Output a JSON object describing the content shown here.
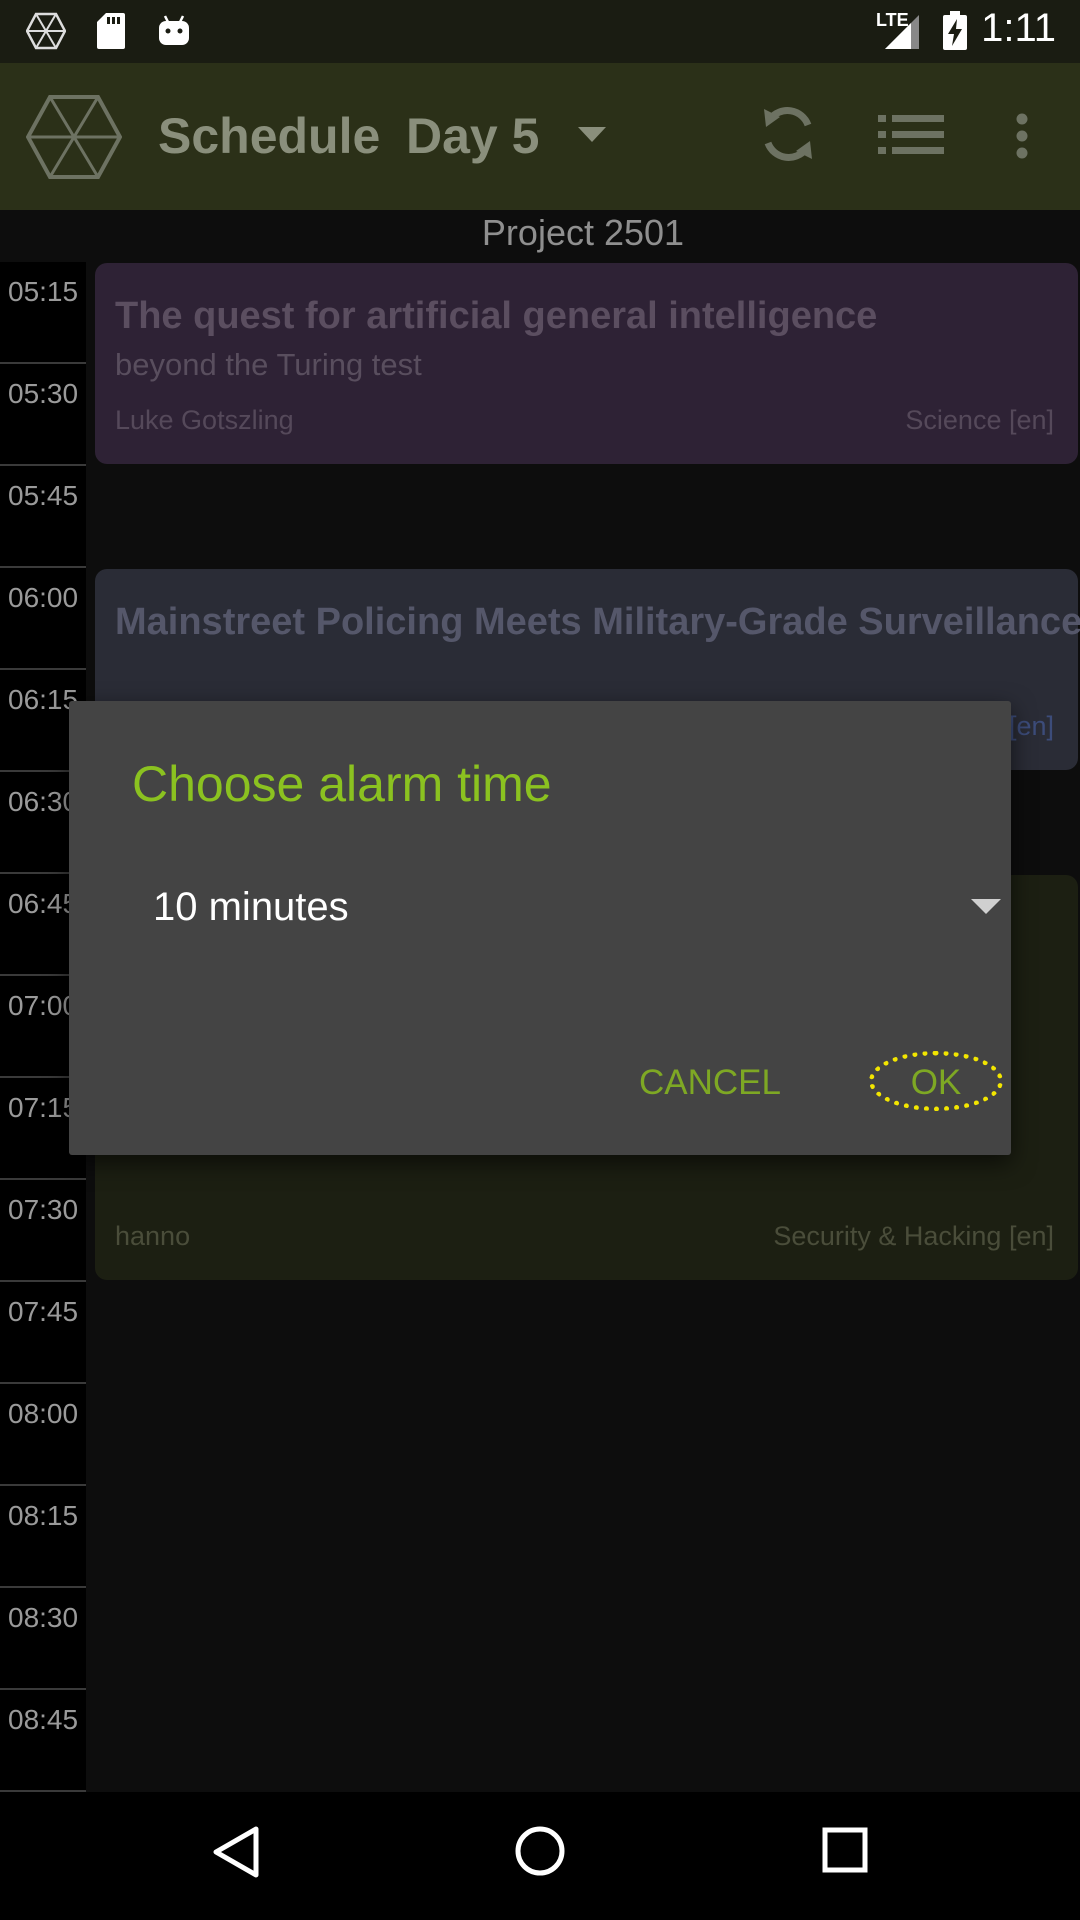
{
  "status_bar": {
    "time": "1:11",
    "network_label": "LTE",
    "icons": [
      "app-logo-icon",
      "sd-card-icon",
      "android-icon",
      "signal-icon",
      "battery-charging-icon"
    ]
  },
  "app_bar": {
    "title": "Schedule",
    "day": "Day 5",
    "icons": [
      "app-logo-icon",
      "dropdown-arrow-icon",
      "refresh-icon",
      "list-view-icon",
      "overflow-menu-icon"
    ]
  },
  "schedule": {
    "track_name": "Project 2501",
    "times": [
      "05:15",
      "05:30",
      "05:45",
      "06:00",
      "06:15",
      "06:30",
      "06:45",
      "07:00",
      "07:15",
      "07:30",
      "07:45",
      "08:00",
      "08:15",
      "08:30",
      "08:45"
    ],
    "events": [
      {
        "title": "The quest for artificial general intelligence",
        "subtitle": "beyond the Turing test",
        "speaker": "Luke Gotszling",
        "track": "Science [en]",
        "color": "#2e2235"
      },
      {
        "title": "Mainstreet Policing Meets Military-Grade Surveillance",
        "subtitle": "",
        "speaker": "",
        "track": "[en]",
        "color": "#2a2c36"
      },
      {
        "title": "",
        "subtitle": "",
        "speaker": "hanno",
        "track": "Security & Hacking [en]",
        "color": "#1c1f12"
      }
    ]
  },
  "dialog": {
    "title": "Choose alarm time",
    "selected_option": "10 minutes",
    "cancel_label": "CANCEL",
    "ok_label": "OK"
  },
  "colors": {
    "accent": "#8bc220",
    "dialog_bg": "#444444",
    "app_bar_bg": "#2b3018",
    "highlight_ring": "#f3e600"
  },
  "nav_bar": {
    "icons": [
      "back-icon",
      "home-icon",
      "recents-icon"
    ]
  }
}
